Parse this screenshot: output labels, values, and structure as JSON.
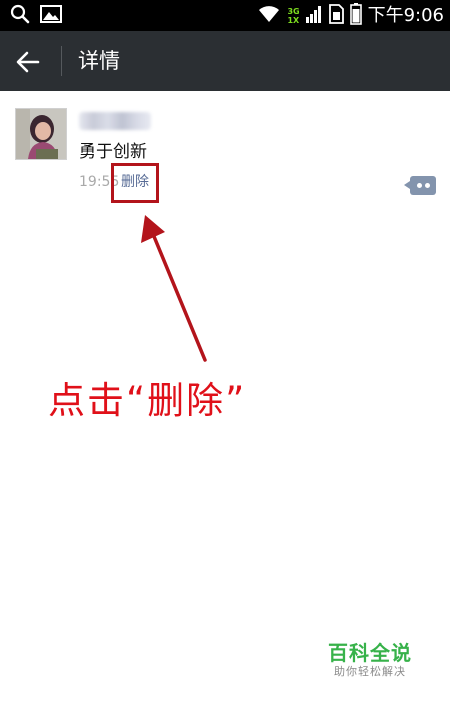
{
  "status_bar": {
    "time": "下午9:06",
    "network_top": "3G",
    "network_bottom": "1X",
    "icons": [
      "search-icon",
      "gallery-icon",
      "wifi-icon",
      "signal-icon",
      "sim-icon",
      "battery-icon"
    ]
  },
  "header": {
    "title": "详情"
  },
  "post": {
    "text": "勇于创新",
    "time": "19:55",
    "delete_label": "删除"
  },
  "annotation": {
    "text": "点击“删除”",
    "color": "#e01019"
  },
  "watermark": {
    "main": "百科全说",
    "sub": "助你轻松解决"
  },
  "colors": {
    "header_bg": "#2b2f33",
    "link_blue": "#576b95",
    "highlight_red": "#b3141b",
    "watermark_green": "#37b24a"
  }
}
